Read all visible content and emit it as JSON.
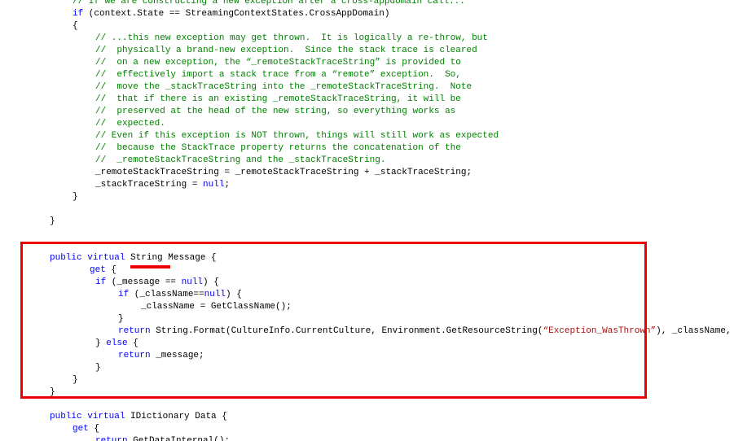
{
  "colors": {
    "keyword": "#0000ff",
    "comment": "#008000",
    "string": "#a31515",
    "text": "#000000",
    "annotation": "#ee0000"
  },
  "annotations": {
    "highlight_box": "red-rectangle",
    "underline": "red-underline-under-String"
  },
  "code_lines": [
    {
      "indent": 89,
      "tokens": [
        {
          "c": "cm",
          "t": "// If we are constructing a new exception after a cross-appdomain call..."
        }
      ]
    },
    {
      "indent": 89,
      "tokens": [
        {
          "c": "kw",
          "t": "if"
        },
        {
          "c": "pl",
          "t": " (context.State == StreamingContextStates.CrossAppDomain)"
        }
      ]
    },
    {
      "indent": 89,
      "tokens": [
        {
          "c": "pl",
          "t": "{"
        }
      ]
    },
    {
      "indent": 117,
      "tokens": [
        {
          "c": "cm",
          "t": "// ...this new exception may get thrown.  It is logically a re-throw, but"
        }
      ]
    },
    {
      "indent": 117,
      "tokens": [
        {
          "c": "cm",
          "t": "//  physically a brand-new exception.  Since the stack trace is cleared"
        }
      ]
    },
    {
      "indent": 117,
      "tokens": [
        {
          "c": "cm",
          "t": "//  on a new exception, the “_remoteStackTraceString” is provided to"
        }
      ]
    },
    {
      "indent": 117,
      "tokens": [
        {
          "c": "cm",
          "t": "//  effectively import a stack trace from a “remote” exception.  So,"
        }
      ]
    },
    {
      "indent": 117,
      "tokens": [
        {
          "c": "cm",
          "t": "//  move the _stackTraceString into the _remoteStackTraceString.  Note"
        }
      ]
    },
    {
      "indent": 117,
      "tokens": [
        {
          "c": "cm",
          "t": "//  that if there is an existing _remoteStackTraceString, it will be"
        }
      ]
    },
    {
      "indent": 117,
      "tokens": [
        {
          "c": "cm",
          "t": "//  preserved at the head of the new string, so everything works as"
        }
      ]
    },
    {
      "indent": 117,
      "tokens": [
        {
          "c": "cm",
          "t": "//  expected."
        }
      ]
    },
    {
      "indent": 117,
      "tokens": [
        {
          "c": "cm",
          "t": "// Even if this exception is NOT thrown, things will still work as expected"
        }
      ]
    },
    {
      "indent": 117,
      "tokens": [
        {
          "c": "cm",
          "t": "//  because the StackTrace property returns the concatenation of the"
        }
      ]
    },
    {
      "indent": 117,
      "tokens": [
        {
          "c": "cm",
          "t": "//  _remoteStackTraceString and the _stackTraceString."
        }
      ]
    },
    {
      "indent": 117,
      "tokens": [
        {
          "c": "pl",
          "t": "_remoteStackTraceString = _remoteStackTraceString + _stackTraceString;"
        }
      ]
    },
    {
      "indent": 117,
      "tokens": [
        {
          "c": "pl",
          "t": "_stackTraceString = "
        },
        {
          "c": "kw",
          "t": "null"
        },
        {
          "c": "pl",
          "t": ";"
        }
      ]
    },
    {
      "indent": 89,
      "tokens": [
        {
          "c": "pl",
          "t": "}"
        }
      ]
    },
    {
      "indent": 61,
      "tokens": []
    },
    {
      "indent": 61,
      "tokens": [
        {
          "c": "pl",
          "t": "}"
        }
      ]
    },
    {
      "indent": 61,
      "tokens": []
    },
    {
      "indent": 61,
      "tokens": []
    },
    {
      "indent": 61,
      "tokens": [
        {
          "c": "kw",
          "t": "public"
        },
        {
          "c": "pl",
          "t": " "
        },
        {
          "c": "kw",
          "t": "virtual"
        },
        {
          "c": "pl",
          "t": " String Message {"
        }
      ]
    },
    {
      "indent": 110,
      "tokens": [
        {
          "c": "kw",
          "t": "get"
        },
        {
          "c": "pl",
          "t": " {"
        }
      ]
    },
    {
      "indent": 117,
      "tokens": [
        {
          "c": "kw",
          "t": "if"
        },
        {
          "c": "pl",
          "t": " (_message == "
        },
        {
          "c": "kw",
          "t": "null"
        },
        {
          "c": "pl",
          "t": ") {"
        }
      ]
    },
    {
      "indent": 145,
      "tokens": [
        {
          "c": "kw",
          "t": "if"
        },
        {
          "c": "pl",
          "t": " (_className=="
        },
        {
          "c": "kw",
          "t": "null"
        },
        {
          "c": "pl",
          "t": ") {"
        }
      ]
    },
    {
      "indent": 173,
      "tokens": [
        {
          "c": "pl",
          "t": "_className = GetClassName();"
        }
      ]
    },
    {
      "indent": 145,
      "tokens": [
        {
          "c": "pl",
          "t": "}"
        }
      ]
    },
    {
      "indent": 145,
      "tokens": [
        {
          "c": "kw",
          "t": "return"
        },
        {
          "c": "pl",
          "t": " String.Format(CultureInfo.CurrentCulture, Environment.GetResourceString("
        },
        {
          "c": "st",
          "t": "“Exception_WasThrown”"
        },
        {
          "c": "pl",
          "t": "), _className, _message);"
        }
      ]
    },
    {
      "indent": 117,
      "tokens": [
        {
          "c": "pl",
          "t": "} "
        },
        {
          "c": "kw",
          "t": "else"
        },
        {
          "c": "pl",
          "t": " {"
        }
      ]
    },
    {
      "indent": 145,
      "tokens": [
        {
          "c": "kw",
          "t": "return"
        },
        {
          "c": "pl",
          "t": " _message;"
        }
      ]
    },
    {
      "indent": 117,
      "tokens": [
        {
          "c": "pl",
          "t": "}"
        }
      ]
    },
    {
      "indent": 89,
      "tokens": [
        {
          "c": "pl",
          "t": "}"
        }
      ]
    },
    {
      "indent": 61,
      "tokens": [
        {
          "c": "pl",
          "t": "}"
        }
      ]
    },
    {
      "indent": 61,
      "tokens": []
    },
    {
      "indent": 61,
      "tokens": [
        {
          "c": "kw",
          "t": "public"
        },
        {
          "c": "pl",
          "t": " "
        },
        {
          "c": "kw",
          "t": "virtual"
        },
        {
          "c": "pl",
          "t": " IDictionary Data {"
        }
      ]
    },
    {
      "indent": 89,
      "tokens": [
        {
          "c": "kw",
          "t": "get"
        },
        {
          "c": "pl",
          "t": " {"
        }
      ]
    },
    {
      "indent": 117,
      "tokens": [
        {
          "c": "kw",
          "t": "return"
        },
        {
          "c": "pl",
          "t": " GetDataInternal();"
        }
      ]
    }
  ]
}
